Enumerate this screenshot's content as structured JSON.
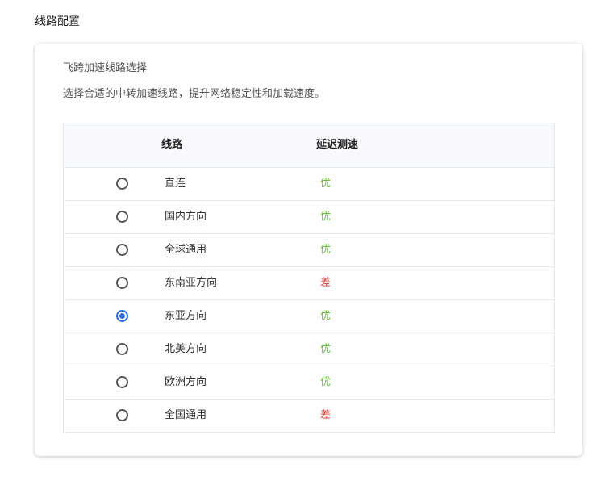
{
  "page": {
    "heading": "线路配置"
  },
  "card": {
    "title": "飞跨加速线路选择",
    "description": "选择合适的中转加速线路，提升网络稳定性和加载速度。"
  },
  "table": {
    "columns": {
      "line": "线路",
      "latency": "延迟测速"
    },
    "rows": [
      {
        "name": "直连",
        "latency": "优",
        "status": "good",
        "selected": false
      },
      {
        "name": "国内方向",
        "latency": "优",
        "status": "good",
        "selected": false
      },
      {
        "name": "全球通用",
        "latency": "优",
        "status": "good",
        "selected": false
      },
      {
        "name": "东南亚方向",
        "latency": "差",
        "status": "bad",
        "selected": false
      },
      {
        "name": "东亚方向",
        "latency": "优",
        "status": "good",
        "selected": true
      },
      {
        "name": "北美方向",
        "latency": "优",
        "status": "good",
        "selected": false
      },
      {
        "name": "欧洲方向",
        "latency": "优",
        "status": "good",
        "selected": false
      },
      {
        "name": "全国通用",
        "latency": "差",
        "status": "bad",
        "selected": false
      }
    ]
  },
  "colors": {
    "good": "#67c23a",
    "bad": "#d9362c",
    "accent": "#2a6fdb"
  }
}
